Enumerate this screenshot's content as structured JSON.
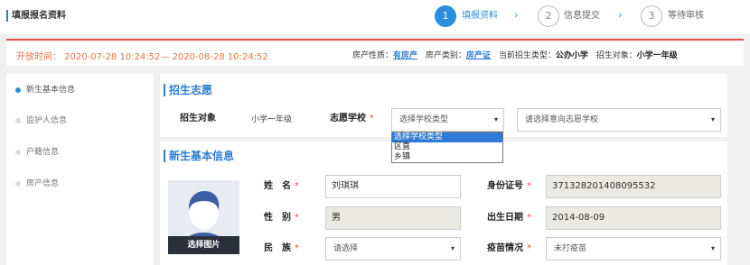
{
  "header": {
    "title": "填报报名资料",
    "steps": [
      {
        "num": "1",
        "label": "填报资料"
      },
      {
        "num": "2",
        "label": "信息提交"
      },
      {
        "num": "3",
        "label": "等待审核"
      }
    ],
    "arrow": "›"
  },
  "info": {
    "open_time": "开放时间： 2020-07-28 10:24:52— 2020-08-28 10:24:52",
    "property_nature_label": "房产性质：",
    "property_nature_value": "有房产",
    "property_type_label": "房产类别：",
    "property_type_value": "房产证",
    "enroll_type_label": "当前招生类型：",
    "enroll_type_value": "公办小学",
    "enroll_target_label": "招生对象：",
    "enroll_target_value": "小学一年级"
  },
  "sidebar": {
    "items": [
      {
        "label": "新生基本信息",
        "active": true
      },
      {
        "label": "监护人信息",
        "active": false
      },
      {
        "label": "户籍信息",
        "active": false
      },
      {
        "label": "房产信息",
        "active": false
      }
    ]
  },
  "preference": {
    "section_title": "招生志愿",
    "target_label": "招生对象",
    "target_value": "小学一年级",
    "school_label": "志愿学校",
    "required_mark": "*",
    "school_type_select": "选择学校类型",
    "school_select_placeholder": "请选择意向志愿学校",
    "dropdown_options": [
      "选择学校类型",
      "区直",
      "乡镇"
    ]
  },
  "basic": {
    "section_title": "新生基本信息",
    "avatar_button": "选择图片",
    "name_label": "姓　名",
    "name_value": "刘琪琪",
    "gender_label": "性　别",
    "gender_value": "男",
    "ethnicity_label": "民　族",
    "ethnicity_value": "请选择",
    "id_label": "身份证号",
    "id_value": "371328201408095532",
    "birth_label": "出生日期",
    "birth_value": "2014-08-09",
    "vaccine_label": "疫苗情况",
    "vaccine_value": "未打疫苗",
    "required_mark": "*",
    "caret": "▾"
  },
  "colors": {
    "accent": "#2b8fe0",
    "title_blue": "#2b7cd3",
    "warning_red": "#e54d42",
    "time_orange": "#e8743b"
  }
}
